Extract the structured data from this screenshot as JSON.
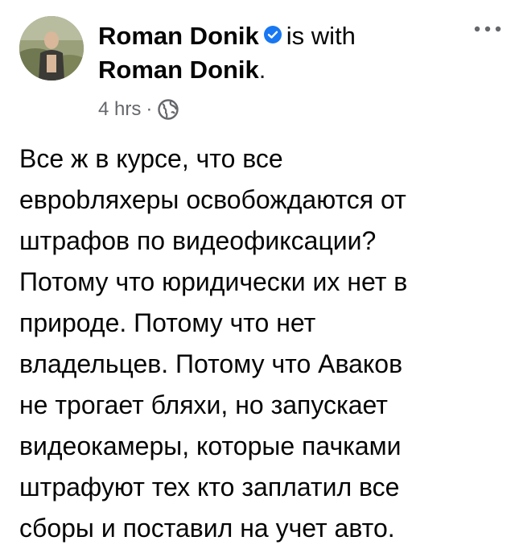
{
  "post": {
    "author": "Roman Donik",
    "with_text": "is with",
    "tagged": "Roman Donik",
    "tagged_suffix": ".",
    "time": "4 hrs",
    "separator": "·",
    "icons": {
      "verified": "verified-badge-icon",
      "privacy": "globe-icon",
      "more": "more-options-icon"
    },
    "text_lines": [
      "Все ж в курсе, что все",
      "еврobляхеры освобождаются от",
      "штрафов по видеофиксации?",
      "Потому что юридически их нет в",
      "природе. Потому что нет",
      "владельцев. Потому что Аваков",
      "не трогает бляхи, но запускает",
      "видеокамеры, которые пачками",
      "штрафуют тех кто заплатил все",
      "сборы и поставил на учет авто."
    ]
  },
  "colors": {
    "verified": "#1877f2",
    "meta": "#65676b",
    "text": "#050505"
  }
}
